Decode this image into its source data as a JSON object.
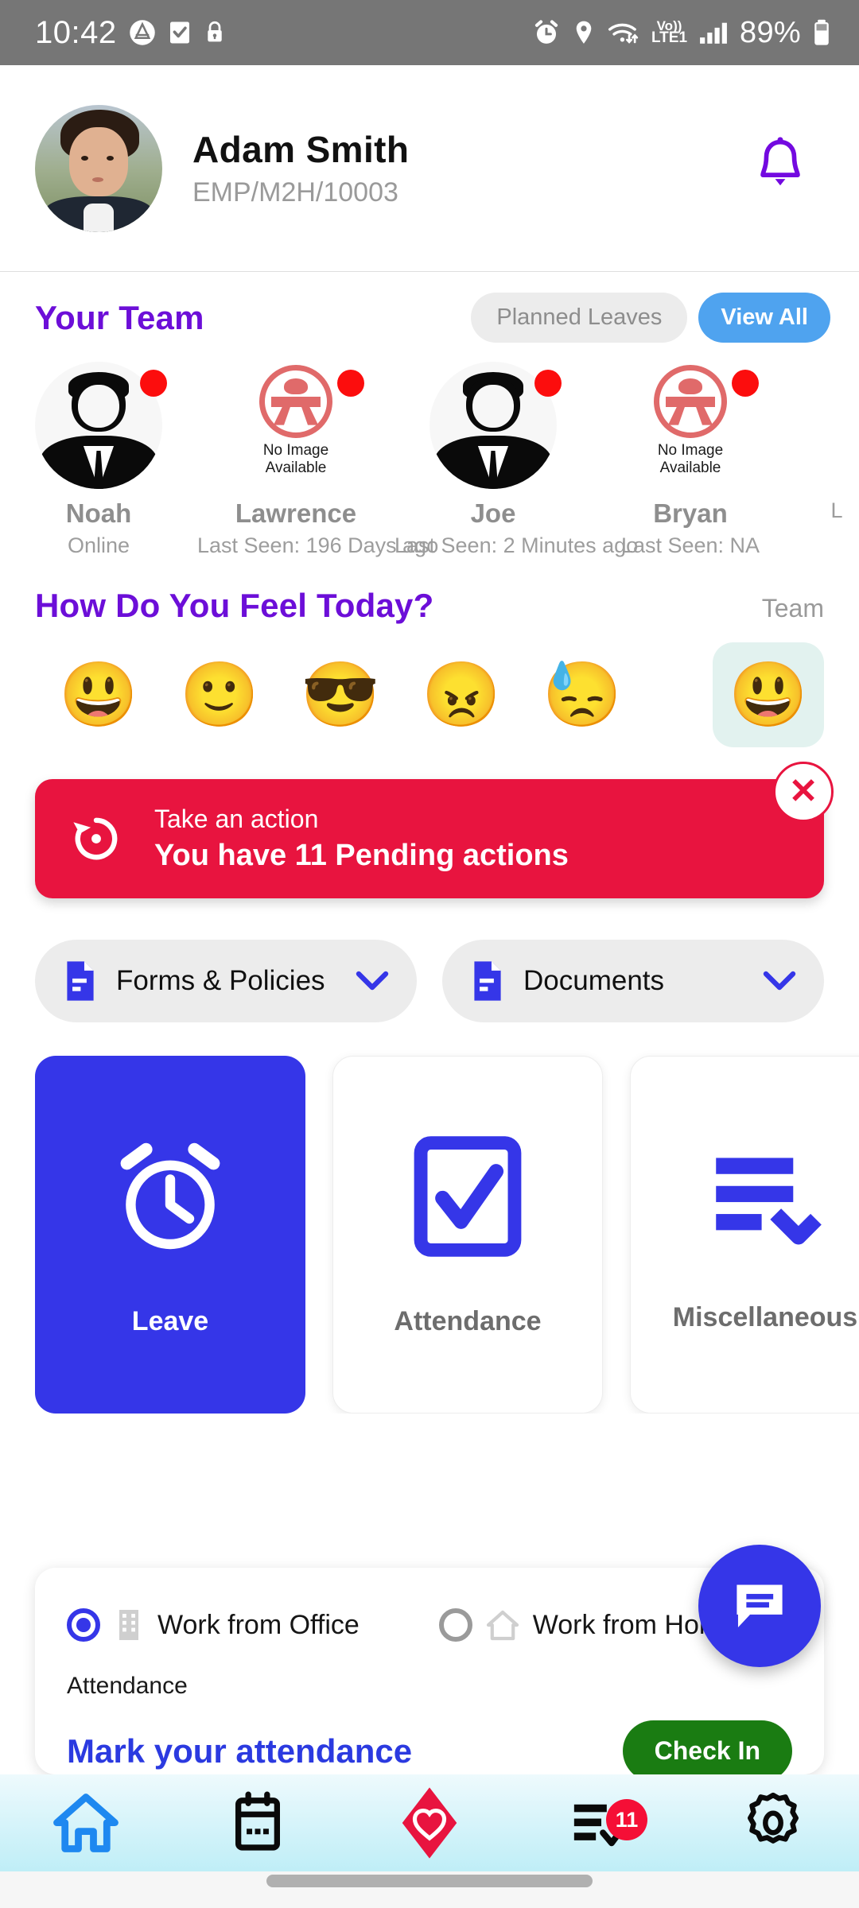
{
  "status_bar": {
    "time": "10:42",
    "battery_percent": "89%",
    "network_label_top": "Vo))",
    "network_label_bottom": "LTE1",
    "icons": [
      "app-circle-icon",
      "task-check-icon",
      "lock-icon",
      "alarm-icon",
      "location-icon",
      "wifi-icon",
      "signal-icon",
      "battery-icon"
    ]
  },
  "profile": {
    "name": "Adam  Smith",
    "employee_id": "EMP/M2H/10003",
    "notification_icon": "bell-icon",
    "accent_purple": "#6C0ED8"
  },
  "team": {
    "title": "Your Team",
    "planned_leaves_label": "Planned Leaves",
    "view_all_label": "View All",
    "no_image_text_line1": "No Image",
    "no_image_text_line2": "Available",
    "members": [
      {
        "name": "Noah",
        "status": "Online",
        "avatar": "person-silhouette",
        "badge_color": "#FC0D0D"
      },
      {
        "name": "Lawrence",
        "status": "Last Seen: 196 Days ago",
        "avatar": "no-image",
        "badge_color": "#FC0D0D"
      },
      {
        "name": "Joe",
        "status": "Last Seen: 2 Minutes ago",
        "avatar": "person-silhouette",
        "badge_color": "#FC0D0D"
      },
      {
        "name": "Bryan",
        "status": "Last Seen: NA",
        "avatar": "no-image",
        "badge_color": "#FC0D0D"
      },
      {
        "name": "",
        "status": "L",
        "avatar": "no-image",
        "badge_color": "#FC0D0D"
      }
    ]
  },
  "mood": {
    "title": "How Do You Feel Today?",
    "team_label": "Team",
    "options": [
      {
        "name": "grinning-face",
        "glyph": "😃"
      },
      {
        "name": "slightly-smiling-face",
        "glyph": "🙂"
      },
      {
        "name": "sunglasses-face",
        "glyph": "😎"
      },
      {
        "name": "angry-face",
        "glyph": "😠"
      },
      {
        "name": "anxious-sweat-face",
        "glyph": "😓"
      }
    ],
    "selected": {
      "name": "grinning-face",
      "glyph": "😃",
      "bg": "#E2F2EF"
    }
  },
  "alert": {
    "icon": "history-restore-icon",
    "title": "Take an action",
    "message": "You have 11 Pending actions",
    "close_label": "✕",
    "bg_color": "#E8143F"
  },
  "dropdowns": [
    {
      "label": "Forms & Policies",
      "icon": "document-icon",
      "chevron": "chevron-down-icon"
    },
    {
      "label": "Documents",
      "icon": "document-icon",
      "chevron": "chevron-down-icon"
    }
  ],
  "tiles": [
    {
      "label": "Leave",
      "icon": "alarm-clock-icon",
      "active": true
    },
    {
      "label": "Attendance",
      "icon": "checkbox-icon",
      "active": false
    },
    {
      "label": "Miscellaneous",
      "icon": "list-arrow-icon",
      "active": false
    }
  ],
  "attendance": {
    "option_office": "Work from Office",
    "option_home": "Work from Home",
    "section_label": "Attendance",
    "mark_label": "Mark your attendance",
    "check_in_label": "Check In",
    "check_in_color": "#1A7C12",
    "selected_option": "Work from Office"
  },
  "fab": {
    "icon": "chat-message-icon",
    "color": "#3536E8"
  },
  "bottom_nav": {
    "items": [
      {
        "name": "home",
        "icon": "home-icon",
        "active": true,
        "badge": ""
      },
      {
        "name": "calendar",
        "icon": "calendar-icon",
        "active": false,
        "badge": ""
      },
      {
        "name": "wellness",
        "icon": "heart-diamond-icon",
        "active": false,
        "badge": ""
      },
      {
        "name": "tasks",
        "icon": "task-list-icon",
        "active": false,
        "badge": "11"
      },
      {
        "name": "settings",
        "icon": "gear-icon",
        "active": false,
        "badge": ""
      }
    ]
  }
}
